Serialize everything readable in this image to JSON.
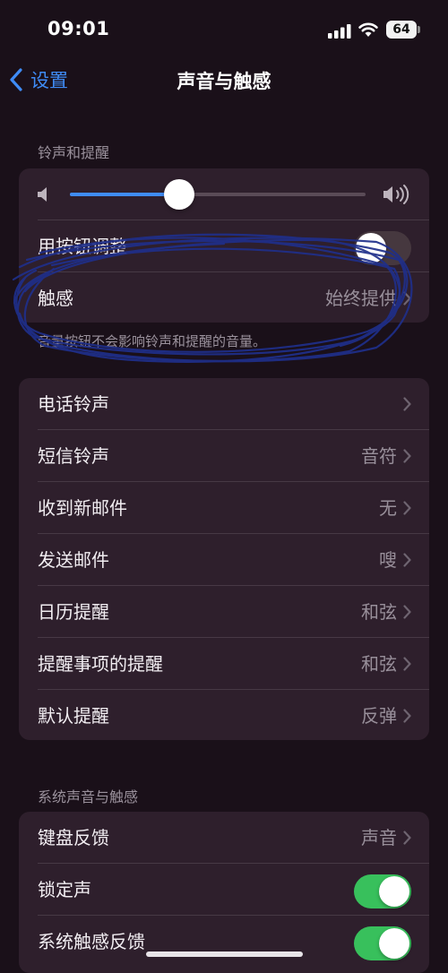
{
  "status_bar": {
    "time": "09:01",
    "battery": "64"
  },
  "nav": {
    "back_label": "设置",
    "title": "声音与触感"
  },
  "ringer_section": {
    "header": "铃声和提醒",
    "volume_level": 0.37,
    "change_with_buttons_label": "用按钮调整",
    "change_with_buttons_on": false,
    "haptics_label": "触感",
    "haptics_value": "始终提供",
    "footer": "音量按钮不会影响铃声和提醒的音量。"
  },
  "sounds": [
    {
      "label": "电话铃声",
      "value": ""
    },
    {
      "label": "短信铃声",
      "value": "音符"
    },
    {
      "label": "收到新邮件",
      "value": "无"
    },
    {
      "label": "发送邮件",
      "value": "嗖"
    },
    {
      "label": "日历提醒",
      "value": "和弦"
    },
    {
      "label": "提醒事项的提醒",
      "value": "和弦"
    },
    {
      "label": "默认提醒",
      "value": "反弹"
    }
  ],
  "system_section": {
    "header": "系统声音与触感",
    "keyboard_feedback_label": "键盘反馈",
    "keyboard_feedback_value": "声音",
    "lock_sound_label": "锁定声",
    "lock_sound_on": true,
    "system_haptics_label": "系统触感反馈",
    "system_haptics_on": true
  },
  "colors": {
    "accent": "#3f8cf6",
    "toggle_on": "#38c05c",
    "background": "#1a1019",
    "cell": "#2e1f2c",
    "annotation_ink": "#1f2f8a"
  }
}
